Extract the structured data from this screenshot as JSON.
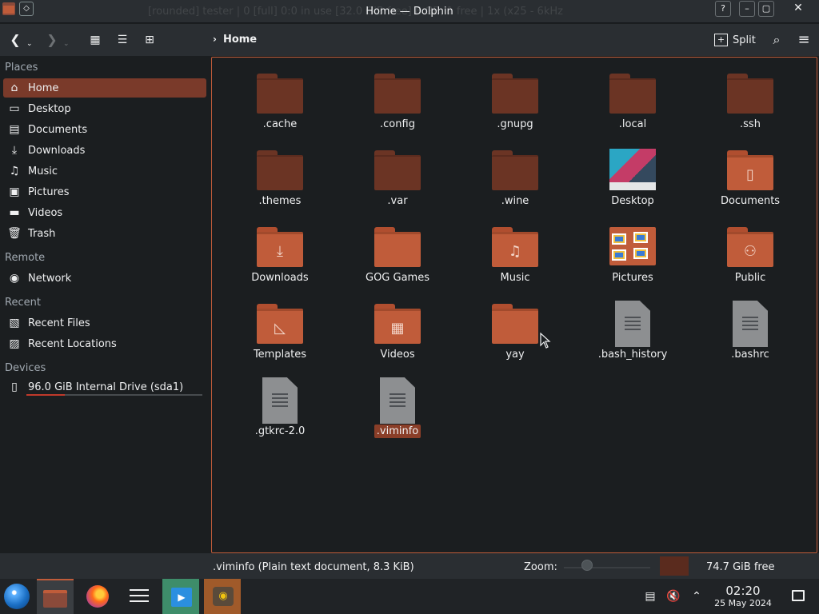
{
  "window": {
    "title": "Home — Dolphin",
    "ghost_title": "[rounded] tester | 0 [full] 0:0 in use [32.0 GiB free] 8 GB, 1 free | 1x (x25 - 6kHz"
  },
  "toolbar": {
    "back_icon": "arrow-left-icon",
    "forward_icon": "arrow-right-icon",
    "breadcrumb": "Home",
    "split_label": "Split"
  },
  "sidebar": {
    "places_title": "Places",
    "places": [
      {
        "label": "Home",
        "icon": "home-icon"
      },
      {
        "label": "Desktop",
        "icon": "desktop-icon"
      },
      {
        "label": "Documents",
        "icon": "documents-icon"
      },
      {
        "label": "Downloads",
        "icon": "downloads-icon"
      },
      {
        "label": "Music",
        "icon": "music-icon"
      },
      {
        "label": "Pictures",
        "icon": "pictures-icon"
      },
      {
        "label": "Videos",
        "icon": "videos-icon"
      },
      {
        "label": "Trash",
        "icon": "trash-icon"
      }
    ],
    "remote_title": "Remote",
    "remote": [
      {
        "label": "Network",
        "icon": "network-icon"
      }
    ],
    "recent_title": "Recent",
    "recent": [
      {
        "label": "Recent Files",
        "icon": "recent-files-icon"
      },
      {
        "label": "Recent Locations",
        "icon": "recent-locations-icon"
      }
    ],
    "devices_title": "Devices",
    "devices": [
      {
        "label": "96.0 GiB Internal Drive (sda1)",
        "icon": "drive-icon",
        "usage_fraction": 0.22
      }
    ]
  },
  "files": [
    {
      "name": ".cache",
      "kind": "folder-dark"
    },
    {
      "name": ".config",
      "kind": "folder-dark"
    },
    {
      "name": ".gnupg",
      "kind": "folder-dark"
    },
    {
      "name": ".local",
      "kind": "folder-dark"
    },
    {
      "name": ".ssh",
      "kind": "folder-dark"
    },
    {
      "name": ".themes",
      "kind": "folder-dark"
    },
    {
      "name": ".var",
      "kind": "folder-dark"
    },
    {
      "name": ".wine",
      "kind": "folder-dark"
    },
    {
      "name": "Desktop",
      "kind": "desktop"
    },
    {
      "name": "Documents",
      "kind": "folder-documents"
    },
    {
      "name": "Downloads",
      "kind": "folder-downloads"
    },
    {
      "name": "GOG Games",
      "kind": "folder-bright"
    },
    {
      "name": "Music",
      "kind": "folder-music"
    },
    {
      "name": "Pictures",
      "kind": "pictures"
    },
    {
      "name": "Public",
      "kind": "folder-public"
    },
    {
      "name": "Templates",
      "kind": "folder-templates"
    },
    {
      "name": "Videos",
      "kind": "folder-videos"
    },
    {
      "name": "yay",
      "kind": "folder-bright"
    },
    {
      "name": ".bash_history",
      "kind": "text-file"
    },
    {
      "name": ".bashrc",
      "kind": "text-file"
    },
    {
      "name": ".gtkrc-2.0",
      "kind": "text-file"
    },
    {
      "name": ".viminfo",
      "kind": "text-file",
      "selected": true
    }
  ],
  "statusbar": {
    "info": ".viminfo (Plain text document, 8.3 KiB)",
    "zoom_label": "Zoom:",
    "free_space": "74.7 GiB free"
  },
  "taskbar": {
    "time": "02:20",
    "date": "25 May 2024"
  },
  "colors": {
    "accent": "#c05c3a",
    "folder_dark": "#6b3424",
    "background": "#1b1e20",
    "panel": "#2a2e32"
  }
}
